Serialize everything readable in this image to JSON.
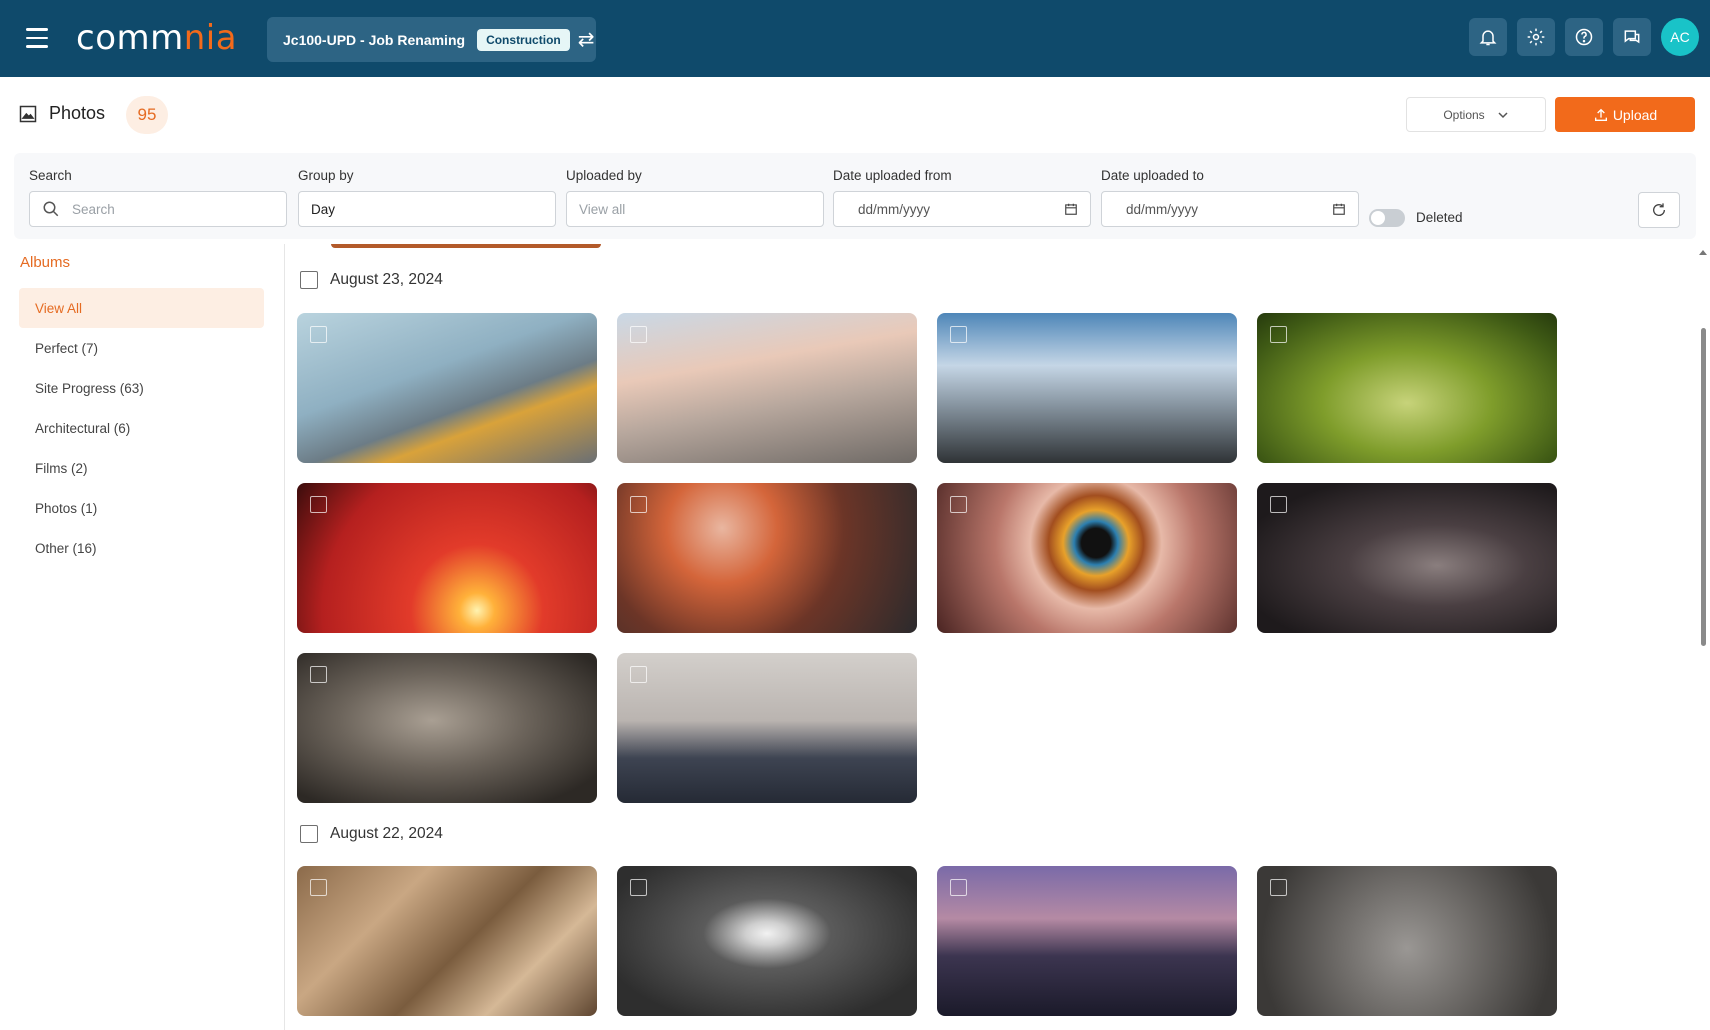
{
  "topbar": {
    "logo_part1": "comm",
    "logo_part2": "nia",
    "job_name": "Jc100-UPD - Job Renaming",
    "job_tag": "Construction",
    "avatar_initials": "AC"
  },
  "header": {
    "title": "Photos",
    "count": "95",
    "options_label": "Options",
    "upload_label": "Upload"
  },
  "filters": {
    "search_label": "Search",
    "search_placeholder": "Search",
    "group_by_label": "Group by",
    "group_by_value": "Day",
    "uploaded_by_label": "Uploaded by",
    "uploaded_by_placeholder": "View all",
    "date_from_label": "Date uploaded from",
    "date_from_placeholder": "dd/mm/yyyy",
    "date_to_label": "Date uploaded to",
    "date_to_placeholder": "dd/mm/yyyy",
    "deleted_label": "Deleted"
  },
  "sidebar": {
    "title": "Albums",
    "items": [
      {
        "label": "View All"
      },
      {
        "label": "Perfect (7)"
      },
      {
        "label": "Site Progress (63)"
      },
      {
        "label": "Architectural (6)"
      },
      {
        "label": "Films (2)"
      },
      {
        "label": "Photos (1)"
      },
      {
        "label": "Other (16)"
      }
    ]
  },
  "groups": [
    {
      "date": "August 23, 2024"
    },
    {
      "date": "August 22, 2024"
    }
  ],
  "colors": {
    "topbar": "#0f4a6b",
    "accent": "#f26a1b",
    "teal": "#19c3c8"
  }
}
